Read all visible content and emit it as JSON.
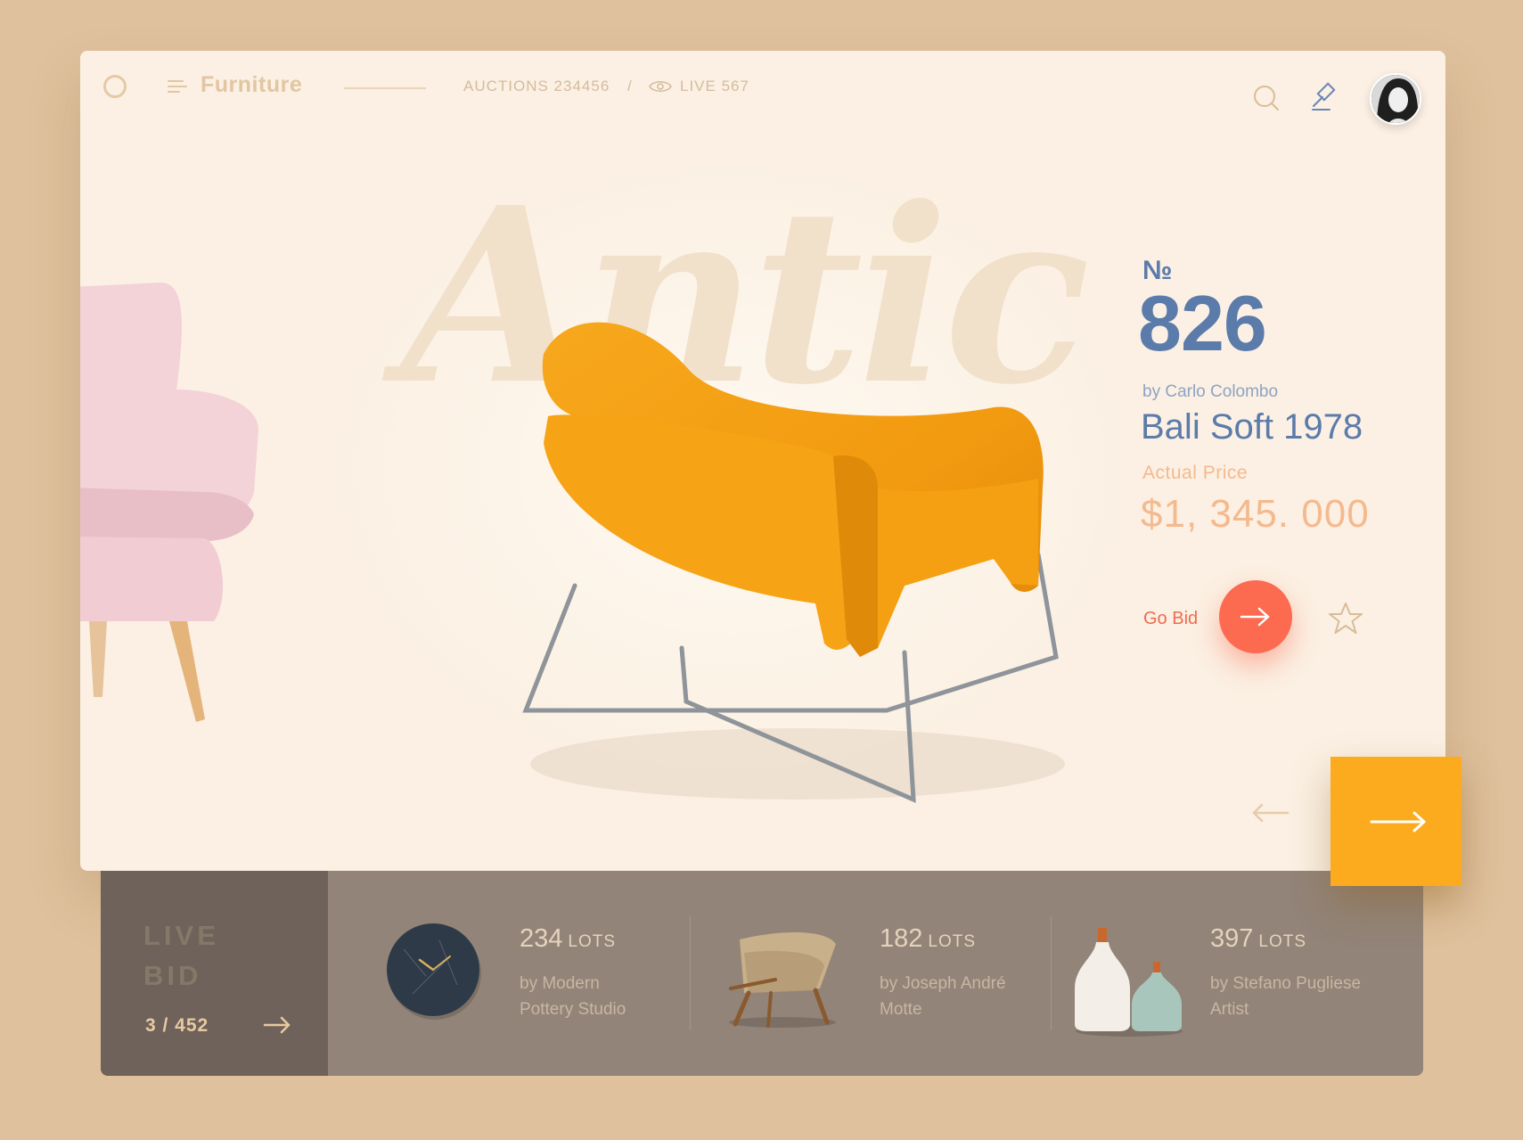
{
  "header": {
    "brand": "Furniture",
    "auctions": "AUCTIONS 234456",
    "separator": "/",
    "live": "LIVE 567"
  },
  "hero": {
    "script_word": "Antic"
  },
  "product": {
    "number_label": "№",
    "number": "826",
    "designer": "by Carlo Colombo",
    "name": "Bali Soft 1978",
    "price_label": "Actual Price",
    "price": "$1, 345. 000",
    "go_bid_label": "Go Bid"
  },
  "live_bid": {
    "title_line1": "LIVE",
    "title_line2": "BID",
    "counter": "3 / 452"
  },
  "lots": [
    {
      "count": "234",
      "unit": "LOTS",
      "by_line1": "by Modern",
      "by_line2": "Pottery Studio"
    },
    {
      "count": "182",
      "unit": "LOTS",
      "by_line1": "by Joseph André",
      "by_line2": "Motte"
    },
    {
      "count": "397",
      "unit": "LOTS",
      "by_line1": "by Stefano Pugliese",
      "by_line2": "Artist"
    }
  ],
  "colors": {
    "background": "#DFC19D",
    "card": "#FBF0E3",
    "accent_blue": "#5B7BAA",
    "price_orange": "#F5B98E",
    "bid_red": "#FC6A50",
    "next_yellow": "#FDAB1E",
    "bottom_bar": "#928478",
    "live_panel": "#6E625A"
  },
  "icons": {
    "logo": "ring-icon",
    "menu": "menu-icon",
    "eye": "eye-icon",
    "search": "search-icon",
    "gavel": "gavel-icon",
    "star": "star-icon",
    "arrow_right": "arrow-right-icon",
    "arrow_left": "arrow-left-icon"
  }
}
